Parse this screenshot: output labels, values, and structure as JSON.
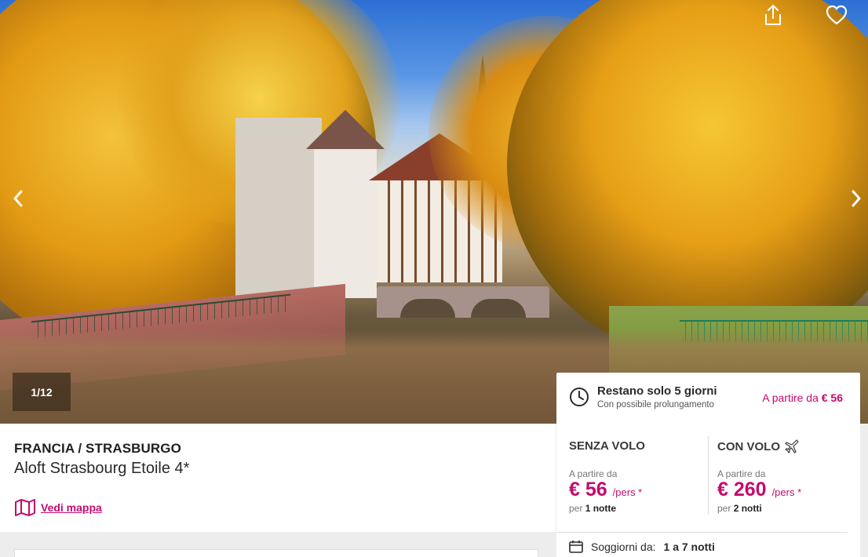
{
  "gallery": {
    "counter": "1/12",
    "prev_icon": "chevron-left-icon",
    "next_icon": "chevron-right-icon",
    "share_icon": "share-icon",
    "favorite_icon": "heart-icon"
  },
  "hotel": {
    "location": "FRANCIA / STRASBURGO",
    "name": "Aloft Strasbourg Etoile 4*",
    "map_link": "Vedi mappa",
    "map_icon": "map-icon"
  },
  "promo": {
    "title": "Restano solo 5 giorni",
    "subtitle": "Con possibile prolungamento",
    "from_label": "A partire da",
    "from_price": "€ 56",
    "clock_icon": "clock-icon"
  },
  "offers": {
    "without_flight": {
      "title": "SENZA VOLO",
      "from_label": "A partire da",
      "price": "€ 56",
      "unit": "/pers *",
      "per_label": "per",
      "nights": "1 notte"
    },
    "with_flight": {
      "title": "CON VOLO",
      "icon": "airplane-icon",
      "from_label": "A partire da",
      "price": "€ 260",
      "unit": "/pers *",
      "per_label": "per",
      "nights": "2 notti"
    }
  },
  "stay": {
    "label": "Soggiorni da:",
    "range": "1 a 7 notti",
    "icon": "calendar-icon"
  },
  "colors": {
    "accent": "#c40b6f",
    "text": "#2a2a2a",
    "background": "#ededed"
  }
}
